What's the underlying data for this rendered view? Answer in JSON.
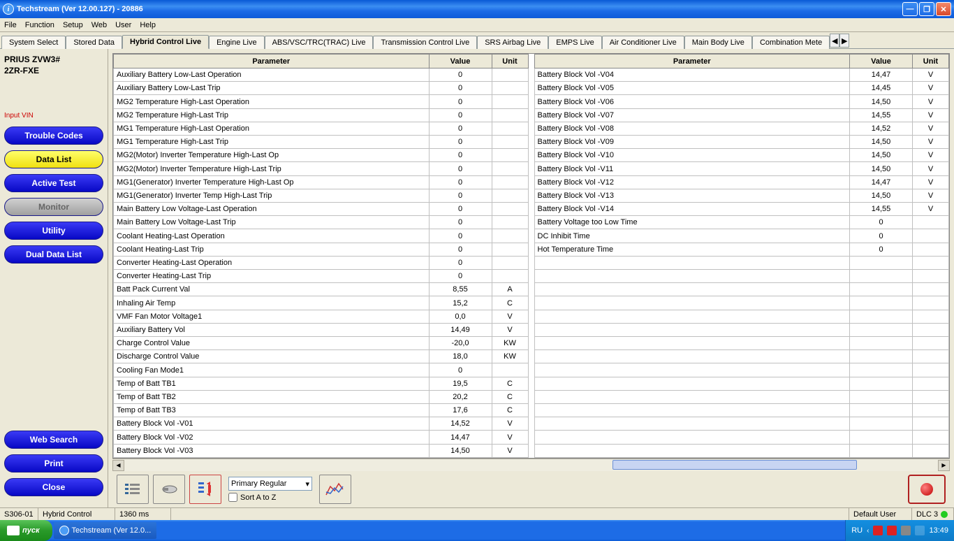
{
  "window": {
    "title": "Techstream (Ver 12.00.127) - 20886"
  },
  "menu": [
    "File",
    "Function",
    "Setup",
    "Web",
    "User",
    "Help"
  ],
  "tabs": [
    "System Select",
    "Stored Data",
    "Hybrid Control Live",
    "Engine Live",
    "ABS/VSC/TRC(TRAC) Live",
    "Transmission Control Live",
    "SRS Airbag Live",
    "EMPS Live",
    "Air Conditioner Live",
    "Main Body Live",
    "Combination Mete"
  ],
  "active_tab": 2,
  "sidebar": {
    "vehicle_line1": "PRIUS ZVW3#",
    "vehicle_line2": "2ZR-FXE",
    "input_vin": "Input VIN",
    "btns": {
      "trouble": "Trouble Codes",
      "datalist": "Data List",
      "active": "Active Test",
      "monitor": "Monitor",
      "utility": "Utility",
      "dual": "Dual Data List",
      "websearch": "Web Search",
      "print": "Print",
      "close": "Close"
    }
  },
  "headers": {
    "param": "Parameter",
    "value": "Value",
    "unit": "Unit"
  },
  "left_table": [
    {
      "p": "Auxiliary Battery Low-Last Operation",
      "v": "0",
      "u": ""
    },
    {
      "p": "Auxiliary Battery Low-Last Trip",
      "v": "0",
      "u": ""
    },
    {
      "p": "MG2 Temperature High-Last Operation",
      "v": "0",
      "u": ""
    },
    {
      "p": "MG2 Temperature High-Last Trip",
      "v": "0",
      "u": ""
    },
    {
      "p": "MG1 Temperature High-Last Operation",
      "v": "0",
      "u": ""
    },
    {
      "p": "MG1 Temperature High-Last Trip",
      "v": "0",
      "u": ""
    },
    {
      "p": "MG2(Motor) Inverter Temperature High-Last Op",
      "v": "0",
      "u": ""
    },
    {
      "p": "MG2(Motor) Inverter Temperature High-Last Trip",
      "v": "0",
      "u": ""
    },
    {
      "p": "MG1(Generator) Inverter Temperature High-Last Op",
      "v": "0",
      "u": ""
    },
    {
      "p": "MG1(Generator) Inverter Temp High-Last Trip",
      "v": "0",
      "u": ""
    },
    {
      "p": "Main Battery Low Voltage-Last Operation",
      "v": "0",
      "u": ""
    },
    {
      "p": "Main Battery Low Voltage-Last Trip",
      "v": "0",
      "u": ""
    },
    {
      "p": "Coolant Heating-Last Operation",
      "v": "0",
      "u": ""
    },
    {
      "p": "Coolant Heating-Last Trip",
      "v": "0",
      "u": ""
    },
    {
      "p": "Converter Heating-Last Operation",
      "v": "0",
      "u": ""
    },
    {
      "p": "Converter Heating-Last Trip",
      "v": "0",
      "u": ""
    },
    {
      "p": "Batt Pack Current Val",
      "v": "8,55",
      "u": "A"
    },
    {
      "p": "Inhaling Air Temp",
      "v": "15,2",
      "u": "C"
    },
    {
      "p": "VMF Fan Motor Voltage1",
      "v": "0,0",
      "u": "V"
    },
    {
      "p": "Auxiliary Battery Vol",
      "v": "14,49",
      "u": "V"
    },
    {
      "p": "Charge Control Value",
      "v": "-20,0",
      "u": "KW"
    },
    {
      "p": "Discharge Control Value",
      "v": "18,0",
      "u": "KW"
    },
    {
      "p": "Cooling Fan Mode1",
      "v": "0",
      "u": ""
    },
    {
      "p": "Temp of Batt TB1",
      "v": "19,5",
      "u": "C"
    },
    {
      "p": "Temp of Batt TB2",
      "v": "20,2",
      "u": "C"
    },
    {
      "p": "Temp of Batt TB3",
      "v": "17,6",
      "u": "C"
    },
    {
      "p": "Battery Block Vol -V01",
      "v": "14,52",
      "u": "V"
    },
    {
      "p": "Battery Block Vol -V02",
      "v": "14,47",
      "u": "V"
    },
    {
      "p": "Battery Block Vol -V03",
      "v": "14,50",
      "u": "V"
    }
  ],
  "right_table": [
    {
      "p": "Battery Block Vol -V04",
      "v": "14,47",
      "u": "V"
    },
    {
      "p": "Battery Block Vol -V05",
      "v": "14,45",
      "u": "V"
    },
    {
      "p": "Battery Block Vol -V06",
      "v": "14,50",
      "u": "V"
    },
    {
      "p": "Battery Block Vol -V07",
      "v": "14,55",
      "u": "V"
    },
    {
      "p": "Battery Block Vol -V08",
      "v": "14,52",
      "u": "V"
    },
    {
      "p": "Battery Block Vol -V09",
      "v": "14,50",
      "u": "V"
    },
    {
      "p": "Battery Block Vol -V10",
      "v": "14,50",
      "u": "V"
    },
    {
      "p": "Battery Block Vol -V11",
      "v": "14,50",
      "u": "V"
    },
    {
      "p": "Battery Block Vol -V12",
      "v": "14,47",
      "u": "V"
    },
    {
      "p": "Battery Block Vol -V13",
      "v": "14,50",
      "u": "V"
    },
    {
      "p": "Battery Block Vol -V14",
      "v": "14,55",
      "u": "V"
    },
    {
      "p": "Battery Voltage too Low Time",
      "v": "0",
      "u": ""
    },
    {
      "p": "DC Inhibit Time",
      "v": "0",
      "u": ""
    },
    {
      "p": "Hot Temperature Time",
      "v": "0",
      "u": ""
    }
  ],
  "right_empty_rows": 15,
  "toolbar": {
    "combo": "Primary Regular",
    "sort": "Sort A to Z"
  },
  "status": {
    "code": "S306-01",
    "system": "Hybrid Control",
    "latency": "1360 ms",
    "user": "Default User",
    "dlc": "DLC 3"
  },
  "taskbar": {
    "start": "пуск",
    "item": "Techstream (Ver 12.0...",
    "lang": "RU",
    "clock": "13:49"
  }
}
